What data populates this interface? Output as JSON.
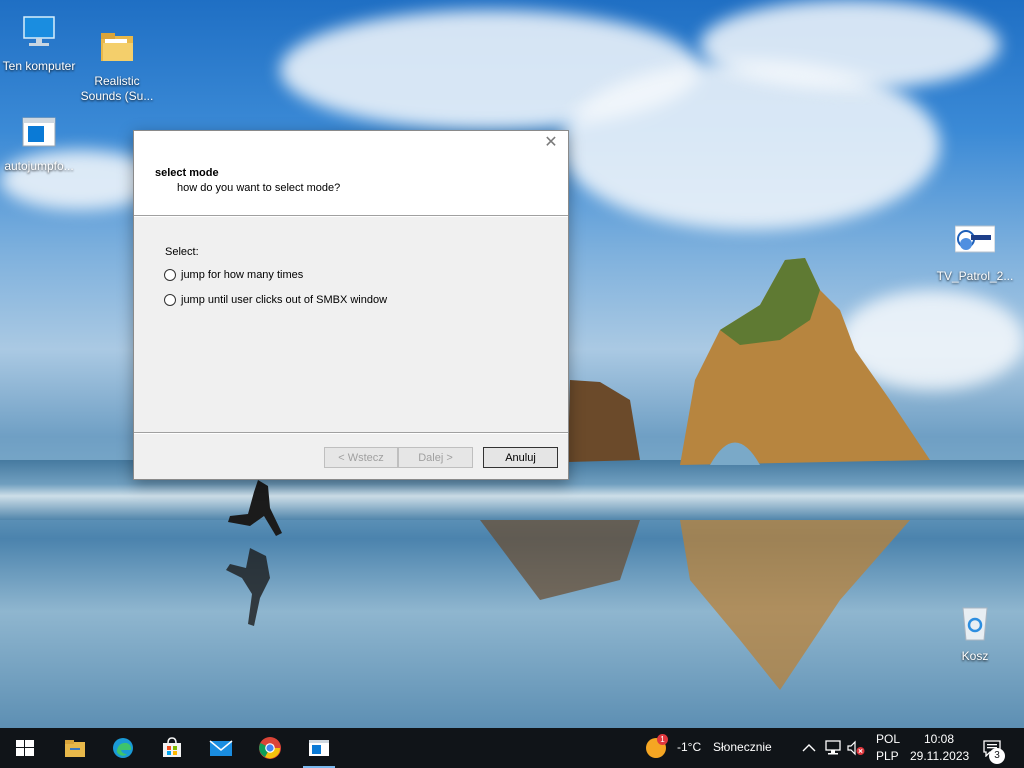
{
  "desktop": {
    "icons": [
      {
        "label": "Ten komputer"
      },
      {
        "label": "Realistic\nSounds (Su..."
      },
      {
        "label": "autojumpfo..."
      },
      {
        "label": "TV_Patrol_2..."
      },
      {
        "label": "Kosz"
      }
    ]
  },
  "dialog": {
    "close_glyph": "✕",
    "header_title": "select mode",
    "header_subtitle": "how do you want to select mode?",
    "select_label": "Select:",
    "options": [
      {
        "label": "jump for how many times",
        "selected": false
      },
      {
        "label": "jump until user clicks out of SMBX window",
        "selected": false
      }
    ],
    "buttons": {
      "back": "< Wstecz",
      "next": "Dalej >",
      "cancel": "Anuluj"
    }
  },
  "taskbar": {
    "apps": [
      "start-icon",
      "file-explorer-icon",
      "edge-icon",
      "store-icon",
      "mail-icon",
      "chrome-icon",
      "app-window-icon"
    ],
    "weather": {
      "badge": "1",
      "temp": "-1°C",
      "condition": "Słonecznie"
    },
    "language": {
      "line1": "POL",
      "line2": "PLP"
    },
    "clock": {
      "time": "10:08",
      "date": "29.11.2023"
    },
    "notifications": "3"
  },
  "colors": {
    "taskbar_bg": "#101418",
    "dialog_bg": "#f0f0f0",
    "accent_blue": "#0078d7"
  }
}
